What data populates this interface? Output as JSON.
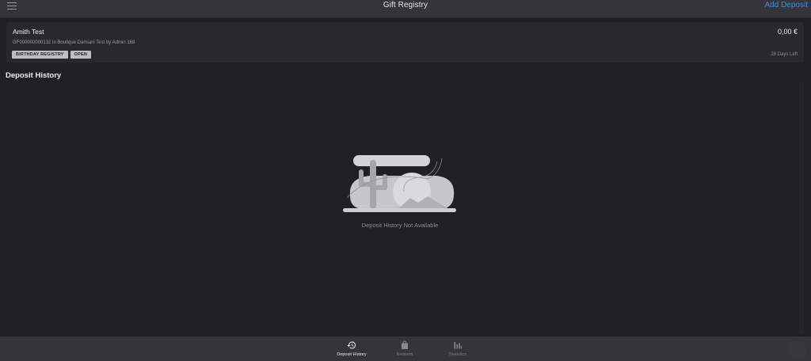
{
  "header": {
    "title": "Gift Registry",
    "action_label": "Add Deposit"
  },
  "registry": {
    "name": "Amith Test",
    "amount": "0,00 €",
    "meta": "GF000000000132 in Boutique Damiani Test by Admin 168",
    "badges": [
      "BIRTHDAY REGISTRY",
      "OPEN"
    ],
    "days_left": "28 Days Left"
  },
  "section": {
    "title": "Deposit History",
    "empty_message": "Deposit History Not Available"
  },
  "bottom_nav": {
    "items": [
      {
        "label": "Deposit History",
        "icon": "history-icon",
        "active": true
      },
      {
        "label": "Redeem",
        "icon": "bag-icon",
        "active": false
      },
      {
        "label": "Statistics",
        "icon": "bar-chart-icon",
        "active": false
      }
    ]
  }
}
